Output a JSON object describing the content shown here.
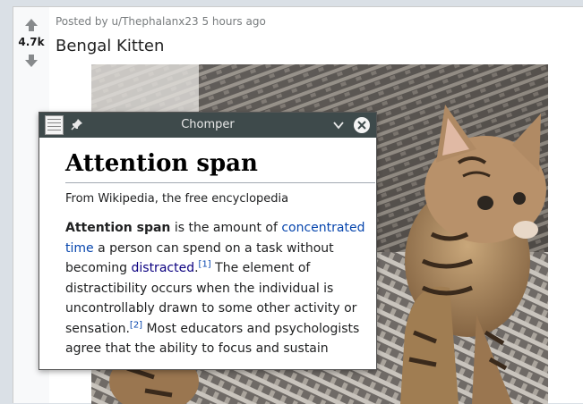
{
  "post": {
    "vote_count": "4.7k",
    "meta": "Posted by u/Thephalanx23 5 hours ago",
    "title": "Bengal Kitten"
  },
  "chomper": {
    "window_title": "Chomper",
    "article": {
      "title": "Attention span",
      "from_line": "From Wikipedia, the free encyclopedia",
      "body": {
        "lead_bold": "Attention span",
        "t1": " is the amount of ",
        "link_concentrated": "concentrated time",
        "t2": " a person can spend on a task without becoming ",
        "link_distracted": "distracted",
        "t3": ".",
        "ref1": "[1]",
        "t4": " The element of distractibility occurs when the individual is uncontrollably drawn to some other activity or sensation.",
        "ref2": "[2]",
        "t5": " Most educators and psychologists agree that the ability to focus and sustain"
      }
    }
  },
  "colors": {
    "link": "#0645ad",
    "titlebar": "#3e4a4b",
    "vote_rail": "#f8f9fa"
  }
}
